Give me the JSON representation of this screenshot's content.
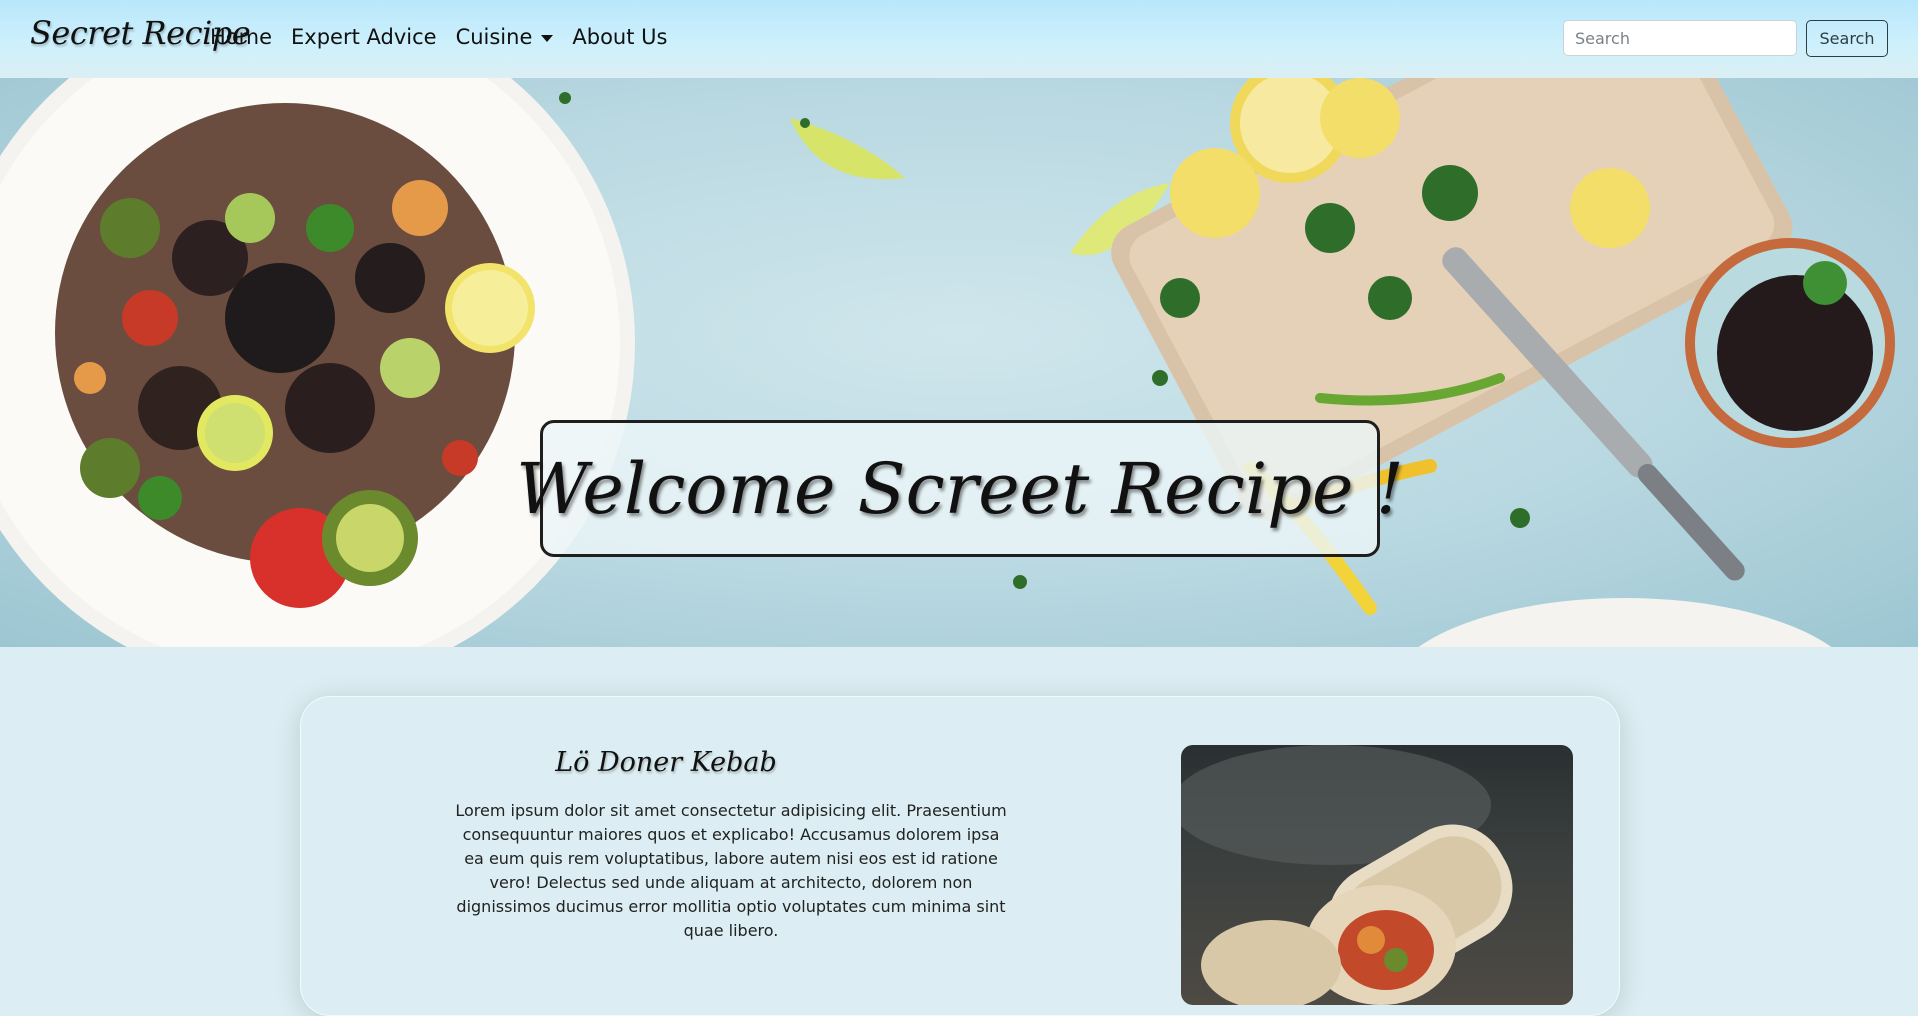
{
  "navbar": {
    "brand": "Secret Recipe",
    "links": [
      {
        "label": "Home"
      },
      {
        "label": "Expert Advice"
      },
      {
        "label": "Cuisine"
      },
      {
        "label": "About Us"
      }
    ],
    "search": {
      "placeholder": "Search",
      "button_label": "Search"
    }
  },
  "hero": {
    "welcome_text": "Welcome Screet Recipe !"
  },
  "card": {
    "title": "Lö Doner Kebab",
    "body": "Lorem ipsum dolor sit amet consectetur adipisicing elit. Praesentium consequuntur maiores quos et explicabo! Accusamus dolorem ipsa ea eum quis rem voluptatibus, labore autem nisi eos est id ratione vero! Delectus sed unde aliquam at architecto, dolorem non dignissimos ducimus error mollitia optio voluptates cum minima sint quae libero."
  }
}
